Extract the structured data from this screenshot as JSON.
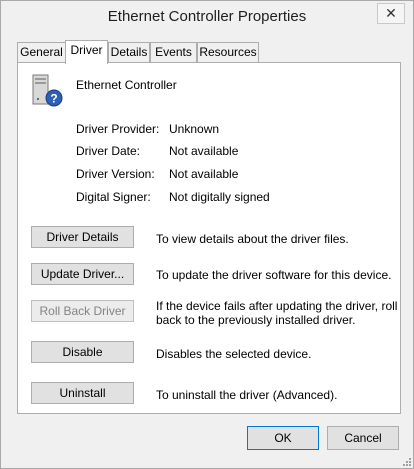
{
  "window": {
    "title": "Ethernet Controller Properties",
    "close_glyph": "✕"
  },
  "tabs": [
    {
      "label": "General",
      "active": false
    },
    {
      "label": "Driver",
      "active": true
    },
    {
      "label": "Details",
      "active": false
    },
    {
      "label": "Events",
      "active": false
    },
    {
      "label": "Resources",
      "active": false
    }
  ],
  "device": {
    "name": "Ethernet Controller",
    "icon": "unknown-device-icon"
  },
  "properties": [
    {
      "label": "Driver Provider:",
      "value": "Unknown"
    },
    {
      "label": "Driver Date:",
      "value": "Not available"
    },
    {
      "label": "Driver Version:",
      "value": "Not available"
    },
    {
      "label": "Digital Signer:",
      "value": "Not digitally signed"
    }
  ],
  "actions": [
    {
      "label": "Driver Details",
      "desc": "To view details about the driver files.",
      "enabled": true
    },
    {
      "label": "Update Driver...",
      "desc": "To update the driver software for this device.",
      "enabled": true
    },
    {
      "label": "Roll Back Driver",
      "desc_line1": "If the device fails after updating the driver, roll",
      "desc_line2": "back to the previously installed driver.",
      "enabled": false
    },
    {
      "label": "Disable",
      "desc": "Disables the selected device.",
      "enabled": true
    },
    {
      "label": "Uninstall",
      "desc": "To uninstall the driver (Advanced).",
      "enabled": true
    }
  ],
  "footer": {
    "ok_label": "OK",
    "cancel_label": "Cancel"
  },
  "colors": {
    "accent": "#0078d7",
    "panel": "#ffffff",
    "chrome": "#f0f0f0"
  }
}
